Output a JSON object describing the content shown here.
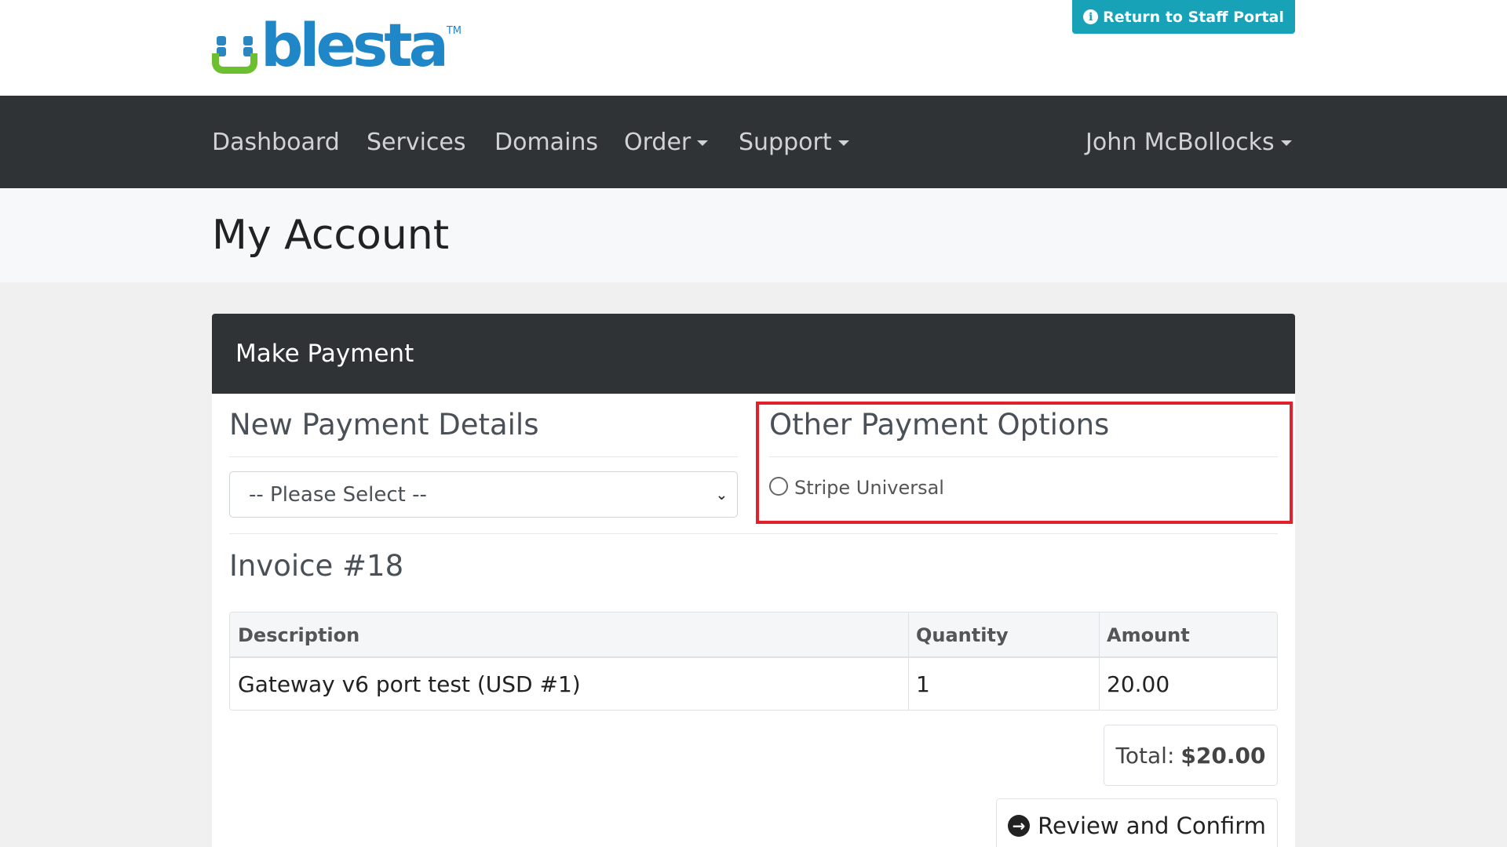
{
  "brand": {
    "name": "blesta",
    "tm": "TM",
    "colors": {
      "text": "#1f86c7",
      "smile": "#6cbf2f"
    }
  },
  "header": {
    "staff_portal_label": "Return to Staff Portal",
    "staff_portal_icon": "info-circle-icon"
  },
  "nav": {
    "dashboard": "Dashboard",
    "services": "Services",
    "domains": "Domains",
    "order": "Order",
    "support": "Support",
    "user": "John McBollocks"
  },
  "page": {
    "title": "My Account"
  },
  "card": {
    "title": "Make Payment"
  },
  "new_payment": {
    "title": "New Payment Details",
    "select_value": "-- Please Select --"
  },
  "other_payment": {
    "title": "Other Payment Options",
    "option_label": "Stripe Universal"
  },
  "invoice": {
    "title": "Invoice #18",
    "columns": {
      "description": "Description",
      "quantity": "Quantity",
      "amount": "Amount"
    },
    "rows": [
      {
        "description": "Gateway v6 port test (USD #1)",
        "quantity": "1",
        "amount": "20.00"
      }
    ],
    "total_label": "Total:",
    "total_value": "$20.00"
  },
  "actions": {
    "review_label": "Review and Confirm",
    "review_icon": "arrow-circle-right-icon"
  },
  "colors": {
    "navbar": "#2f3336",
    "accent": "#17a2b8",
    "highlight": "#e0202a"
  }
}
